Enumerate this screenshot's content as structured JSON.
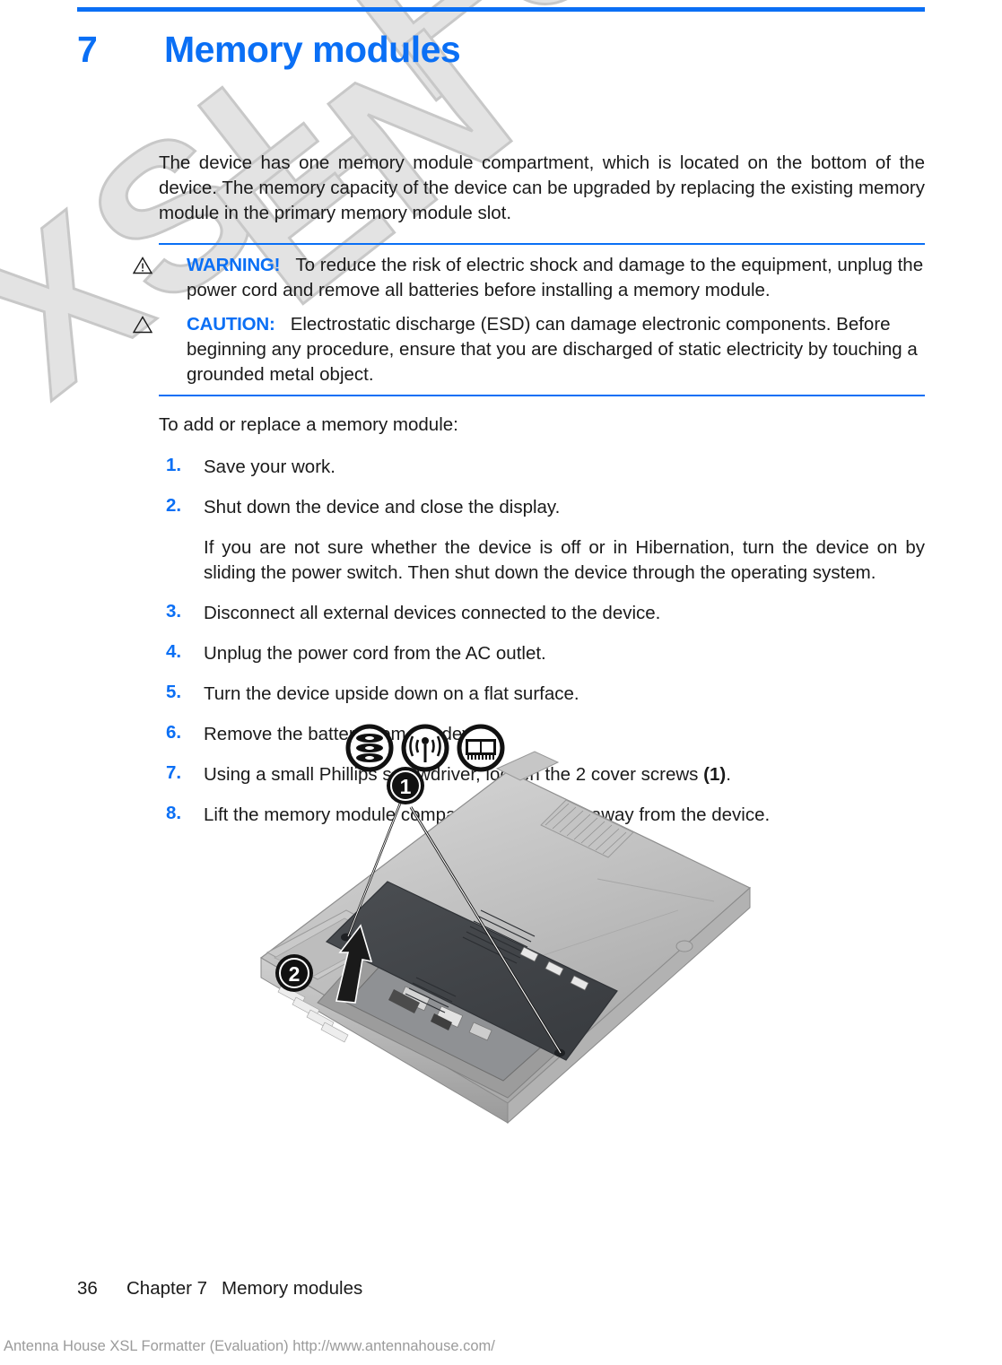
{
  "document": {
    "chapter_number": "7",
    "chapter_title": "Memory modules",
    "accent_color": "#0a6ff5",
    "text_color": "#1a1a1a"
  },
  "intro": {
    "paragraph": "The device has one memory module compartment, which is located on the bottom of the device. The memory capacity of the device can be upgraded by replacing the existing memory module in the primary memory module slot."
  },
  "admonitions": [
    {
      "icon": "warning-triangle-icon",
      "label": "WARNING!",
      "text": "To reduce the risk of electric shock and damage to the equipment, unplug the power cord and remove all batteries before installing a memory module."
    },
    {
      "icon": "caution-triangle-icon",
      "label": "CAUTION:",
      "text": "Electrostatic discharge (ESD) can damage electronic components. Before beginning any procedure, ensure that you are discharged of static electricity by touching a grounded metal object."
    }
  ],
  "lead_in": "To add or replace a memory module:",
  "steps": [
    {
      "num": "1.",
      "text": "Save your work."
    },
    {
      "num": "2.",
      "text": "Shut down the device and close the display.",
      "sub": "If you are not sure whether the device is off or in Hibernation, turn the device on by sliding the power switch. Then shut down the device through the operating system."
    },
    {
      "num": "3.",
      "text": "Disconnect all external devices connected to the device."
    },
    {
      "num": "4.",
      "text": "Unplug the power cord from the AC outlet."
    },
    {
      "num": "5.",
      "text": "Turn the device upside down on a flat surface."
    },
    {
      "num": "6.",
      "text": "Remove the battery from the device."
    },
    {
      "num": "7.",
      "text_before": "Using a small Phillips screwdriver, loosen the 2 cover screws ",
      "callout": "(1)",
      "text_after": "."
    },
    {
      "num": "8.",
      "text_before": "Lift the memory module compartment cover ",
      "callout": "(2)",
      "text_after": " away from the device."
    }
  ],
  "figure": {
    "alt": "Bottom view of device with memory module compartment cover lifted away",
    "icons": [
      "hard-drive-icon",
      "wireless-antenna-icon",
      "memory-module-icon"
    ],
    "callouts": [
      "1",
      "2"
    ]
  },
  "footer": {
    "page_number": "36",
    "chapter_label": "Chapter 7",
    "chapter_title": "Memory modules"
  },
  "evaluation_notice": "Antenna House XSL Formatter (Evaluation)  http://www.antennahouse.com/",
  "watermark": {
    "line1": "XSL Formatter",
    "line2": "EN"
  }
}
